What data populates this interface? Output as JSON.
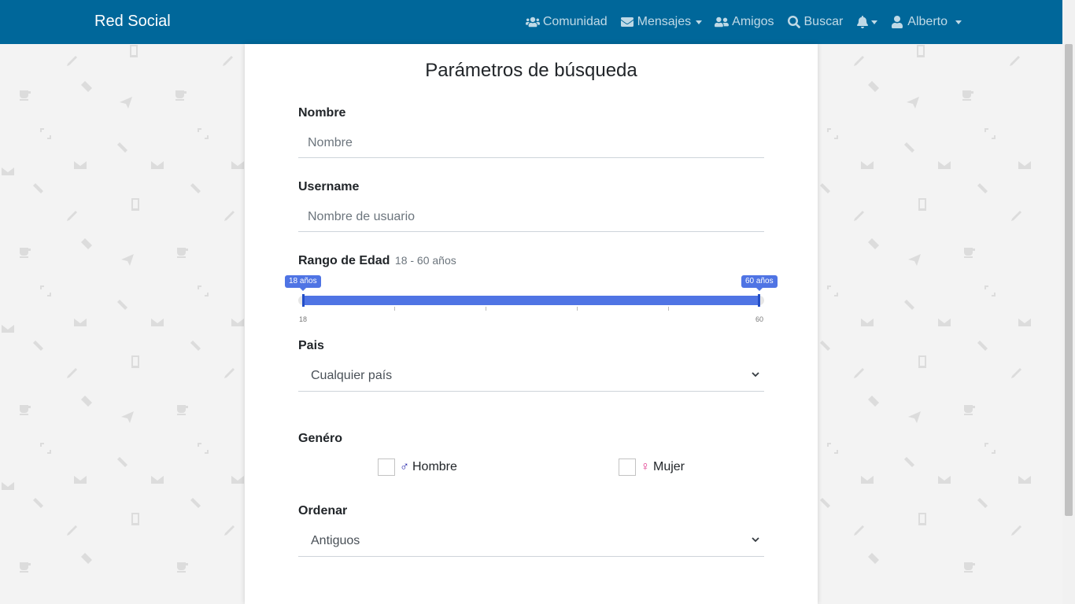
{
  "navbar": {
    "brand": "Red Social",
    "items": [
      {
        "label": "Comunidad",
        "icon": "users-icon"
      },
      {
        "label": "Mensajes",
        "icon": "envelope-icon",
        "dropdown": true
      },
      {
        "label": "Amigos",
        "icon": "user-friends-icon"
      },
      {
        "label": "Buscar",
        "icon": "search-icon"
      },
      {
        "label": "",
        "icon": "bell-icon",
        "dropdown": true
      },
      {
        "label": "Alberto",
        "icon": "user-icon",
        "dropdown": true
      }
    ],
    "color": "#00679a"
  },
  "form": {
    "title": "Parámetros de búsqueda",
    "name_label": "Nombre",
    "name_placeholder": "Nombre",
    "username_label": "Username",
    "username_placeholder": "Nombre de usuario",
    "age_label": "Rango de Edad",
    "age_range_text": "18 - 60 años",
    "age_slider": {
      "min": 18,
      "max": 60,
      "low": 18,
      "high": 60,
      "low_badge": "18 años",
      "high_badge": "60 años",
      "min_label": "18",
      "max_label": "60"
    },
    "country_label": "Pais",
    "country_value": "Cualquier país",
    "gender_label": "Genéro",
    "gender_male": "Hombre",
    "gender_male_symbol": "♂",
    "gender_female": "Mujer",
    "gender_female_symbol": "♀",
    "order_label": "Ordenar",
    "order_value": "Antiguos"
  },
  "colors": {
    "accent": "#4f74e4",
    "male": "#1a1aa6",
    "female": "#e0348a"
  }
}
